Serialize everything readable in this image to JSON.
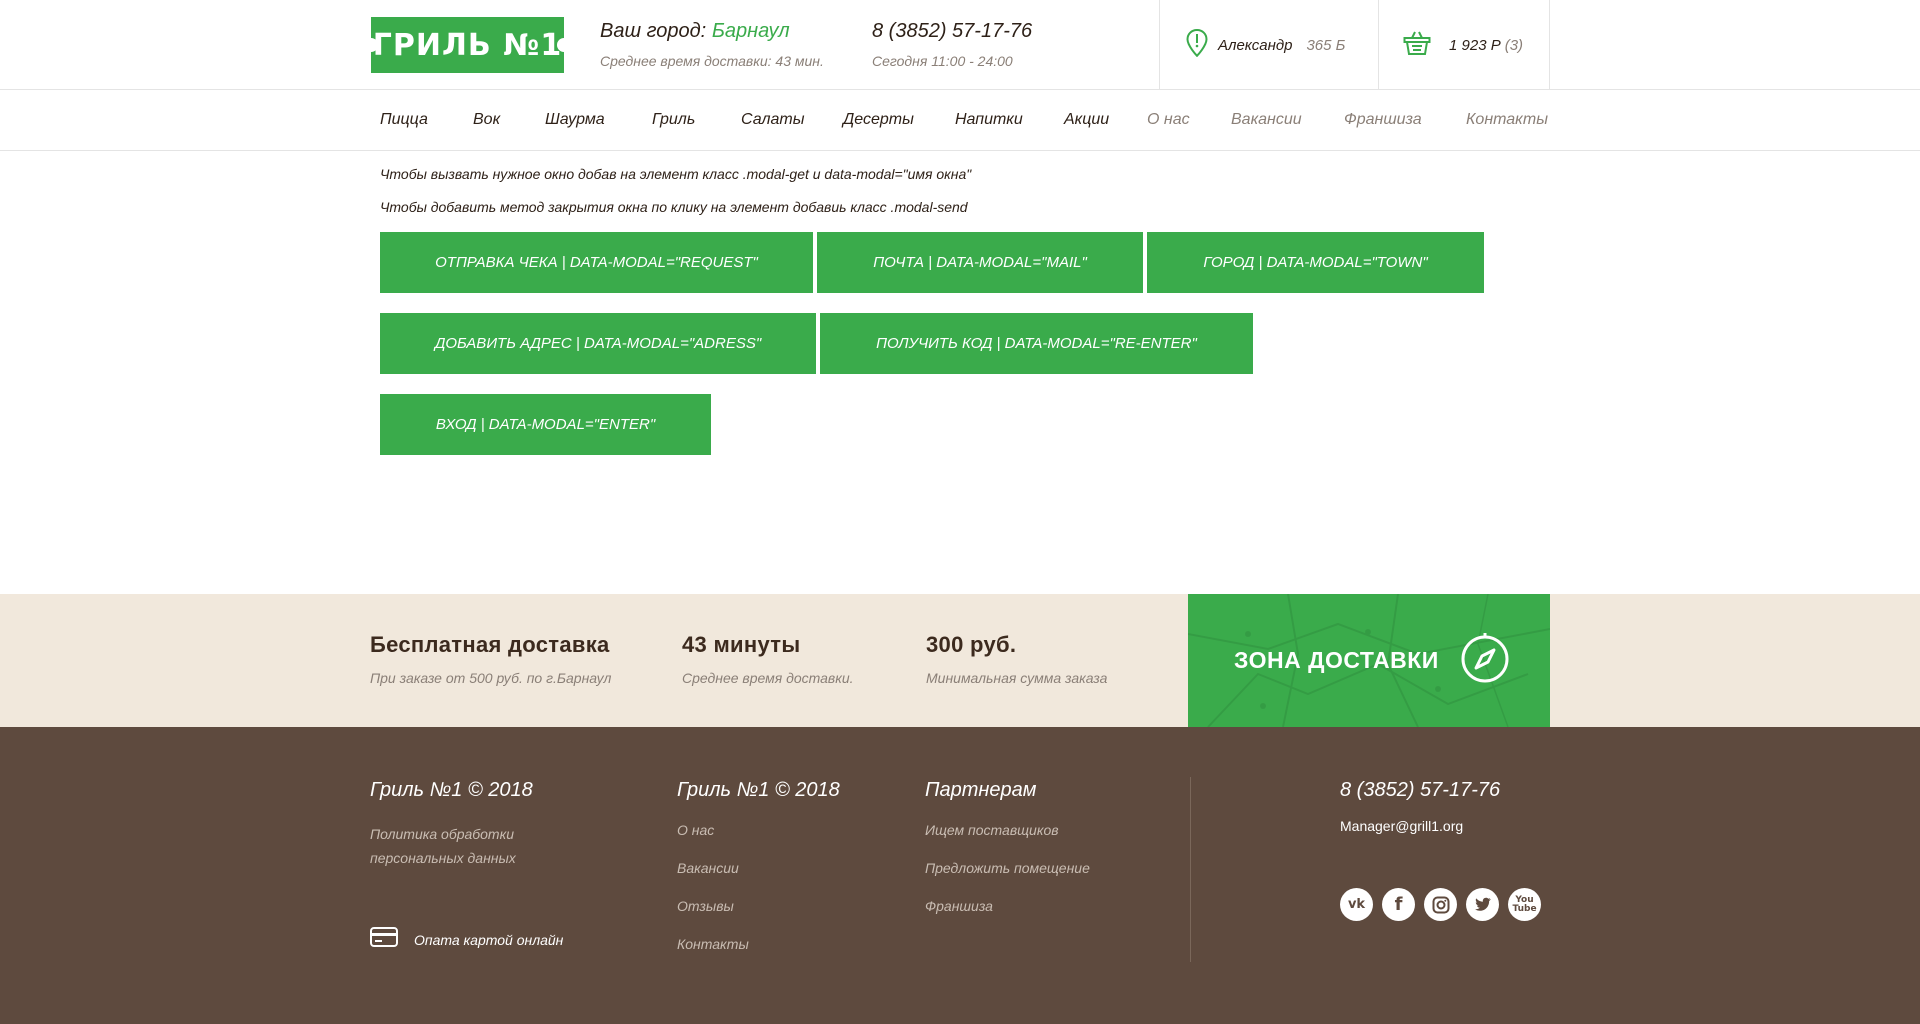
{
  "header": {
    "logo_text": "ГРИЛЬ №1",
    "city_prefix": "Ваш город:",
    "city_name": "Барнаул",
    "delivery_time": "Среднее время доставки: 43 мин.",
    "phone": "8 (3852) 57-17-76",
    "hours": "Сегодня 11:00 - 24:00",
    "user_name": "Александр",
    "user_points": "365 Б",
    "cart_total": "1 923 Р",
    "cart_count": "(3)"
  },
  "nav": {
    "main": [
      "Пицца",
      "Вок",
      "Шаурма",
      "Гриль",
      "Салаты",
      "Десерты",
      "Напитки",
      "Акции"
    ],
    "secondary": [
      "О нас",
      "Вакансии",
      "Франшиза",
      "Контакты"
    ]
  },
  "content": {
    "note1": "Чтобы вызвать нужное окно добав на элемент класс .modal-get и data-modal=\"имя окна\"",
    "note2": "Чтобы добавить метод закрытия окна по клику на элемент добавиь класс .modal-send",
    "buttons": [
      "ОТПРАВКА ЧЕКА | DATA-MODAL=\"REQUEST\"",
      "ПОЧТА | DATA-MODAL=\"MAIL\"",
      "ГОРОД | DATA-MODAL=\"TOWN\"",
      "ДОБАВИТЬ АДРЕС | DATA-MODAL=\"ADRESS\"",
      "ПОЛУЧИТЬ КОД | DATA-MODAL=\"RE-ENTER\"",
      "ВХОД | DATA-MODAL=\"ENTER\""
    ]
  },
  "features": [
    {
      "title": "Бесплатная доставка",
      "subtitle": "При заказе от 500 руб. по г.Барнаул"
    },
    {
      "title": "43 минуты",
      "subtitle": "Среднее время доставки."
    },
    {
      "title": "300 руб.",
      "subtitle": "Минимальная сумма заказа"
    }
  ],
  "zone_label": "ЗОНА ДОСТАВКИ",
  "footer": {
    "col1_title": "Гриль №1 © 2018",
    "policy_line1": "Политика обработки",
    "policy_line2": "персональных данных",
    "pay_label": "Опата картой онлайн",
    "col2_title": "Гриль №1 © 2018",
    "col2_links": [
      "О нас",
      "Вакансии",
      "Отзывы",
      "Контакты"
    ],
    "col3_title": "Партнерам",
    "col3_links": [
      "Ищем поставщиков",
      "Предложить помещение",
      "Франшиза"
    ],
    "phone": "8 (3852) 57-17-76",
    "email": "Manager@grill1.org",
    "socials": [
      "vk-icon",
      "facebook-icon",
      "instagram-icon",
      "twitter-icon",
      "youtube-icon"
    ]
  },
  "colors": {
    "accent": "#3aab4b",
    "footer_bg": "#5e4a3e",
    "strip_bg": "#f1e8dc",
    "text_dark": "#2e2118",
    "text_muted": "#8a7f77"
  }
}
